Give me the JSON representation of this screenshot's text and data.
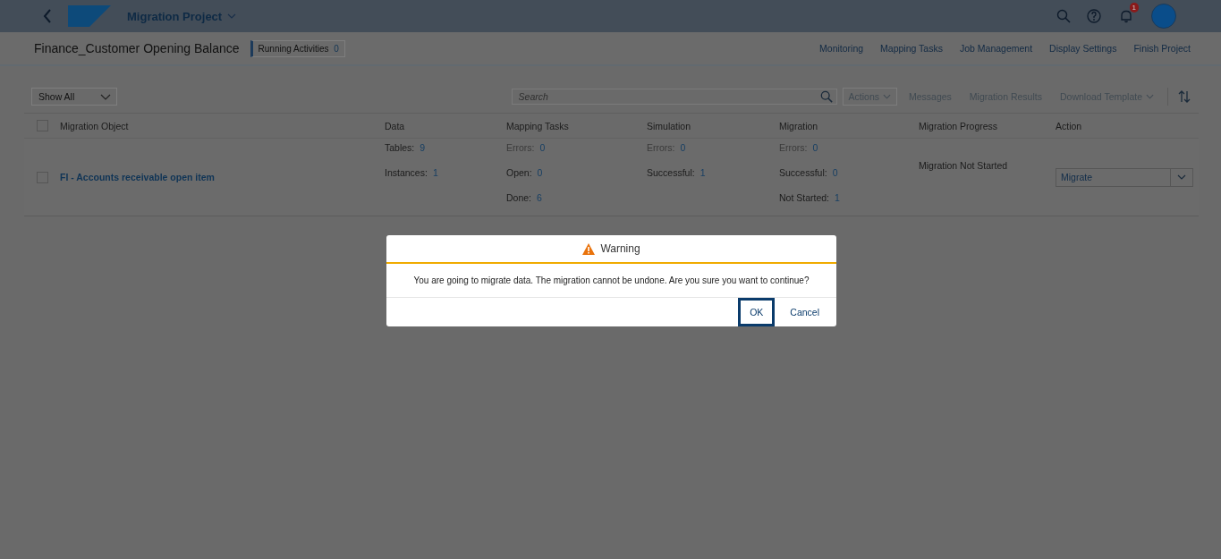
{
  "shell": {
    "title": "Migration Project",
    "notification_count": "1"
  },
  "header": {
    "title": "Finance_Customer Opening Balance",
    "running_label": "Running Activities",
    "running_count": "0",
    "links": [
      "Monitoring",
      "Mapping Tasks",
      "Job Management",
      "Display Settings",
      "Finish Project"
    ]
  },
  "toolbar": {
    "filter": "Show All",
    "search": {
      "placeholder": "Search"
    },
    "buttons": [
      {
        "label": "Actions",
        "menu": true,
        "bordered": true,
        "disabled": true
      },
      {
        "label": "Messages",
        "menu": false,
        "bordered": false,
        "disabled": true
      },
      {
        "label": "Migration Results",
        "menu": false,
        "bordered": false,
        "disabled": true
      },
      {
        "label": "Download Template",
        "menu": true,
        "bordered": false,
        "disabled": true
      }
    ]
  },
  "table": {
    "select_all_checked": false,
    "columns": [
      "Migration Object",
      "Data",
      "Mapping Tasks",
      "Simulation",
      "Migration",
      "Migration Progress",
      "Action"
    ],
    "rows": [
      {
        "checked": false,
        "object": "FI - Accounts receivable open item",
        "data": [
          {
            "label": "Tables:",
            "value": "9",
            "dimmed": false
          },
          {
            "label": "Instances:",
            "value": "1",
            "dimmed": false
          }
        ],
        "mapping": [
          {
            "label": "Errors:",
            "value": "0",
            "dimmed": true
          },
          {
            "label": "Open:",
            "value": "0",
            "dimmed": false
          },
          {
            "label": "Done:",
            "value": "6",
            "dimmed": false
          }
        ],
        "simulation": [
          {
            "label": "Errors:",
            "value": "0",
            "dimmed": true
          },
          {
            "label": "Successful:",
            "value": "1",
            "dimmed": false
          }
        ],
        "migration": [
          {
            "label": "Errors:",
            "value": "0",
            "dimmed": true
          },
          {
            "label": "Successful:",
            "value": "0",
            "dimmed": false
          },
          {
            "label": "Not Started:",
            "value": "1",
            "dimmed": false
          }
        ],
        "progress": "Migration Not Started",
        "action": "Migrate"
      }
    ]
  },
  "dialog": {
    "title": "Warning",
    "message": "You are going to migrate data. The migration cannot be undone. Are you sure you want to continue?",
    "buttons": [
      {
        "label": "OK",
        "focused": true
      },
      {
        "label": "Cancel",
        "focused": false
      }
    ]
  }
}
